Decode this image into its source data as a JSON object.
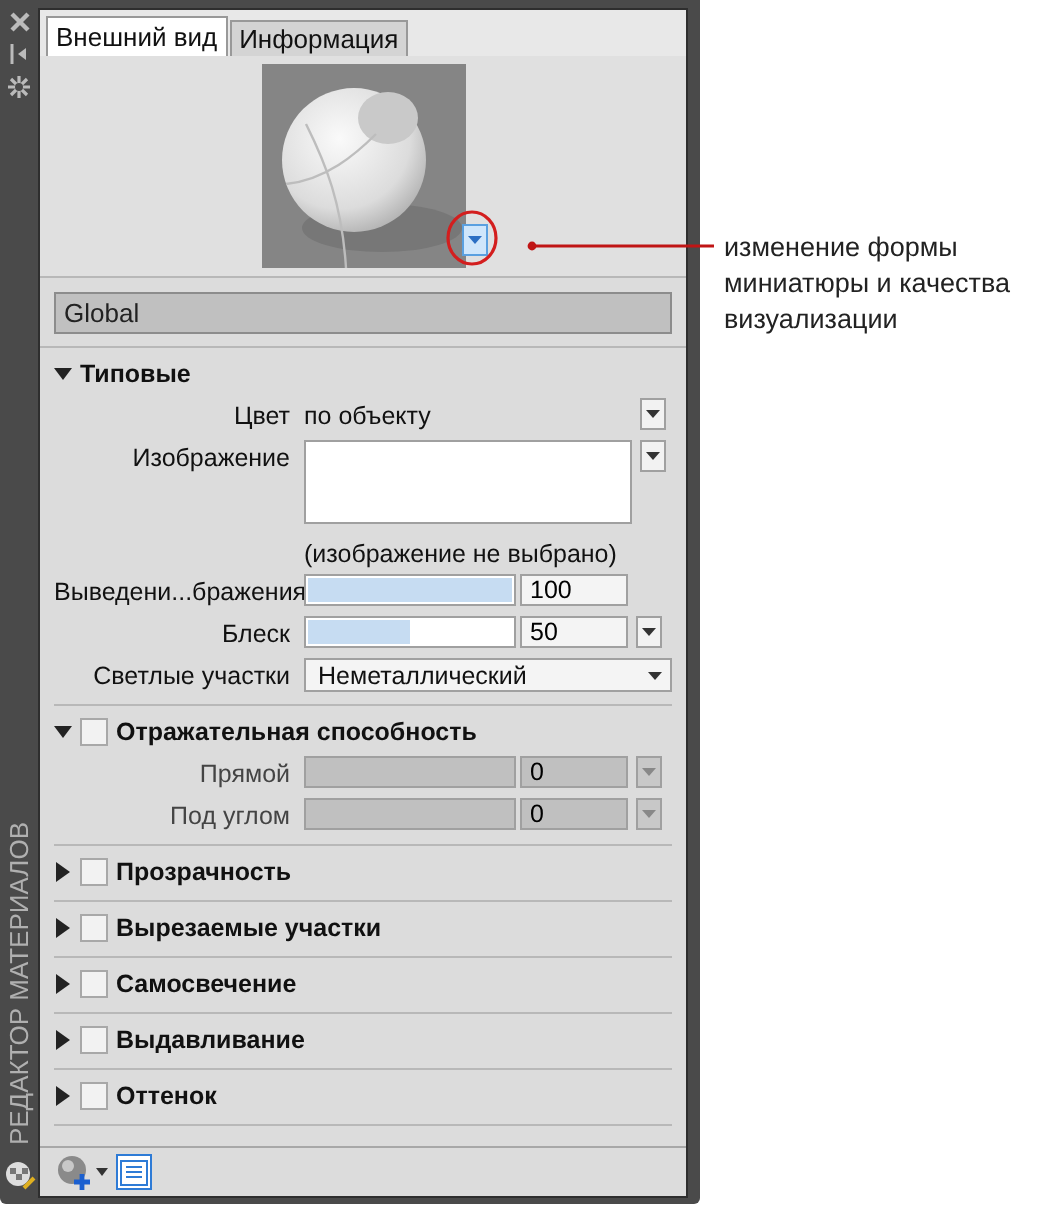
{
  "side_bar": {
    "title": "РЕДАКТОР МАТЕРИАЛОВ"
  },
  "tabs": [
    {
      "label": "Внешний вид",
      "selected": true
    },
    {
      "label": "Информация",
      "selected": false
    }
  ],
  "material_name": "Global",
  "callout": "изменение формы миниатюры и качества визуализации",
  "sections": [
    {
      "title": "Типовые",
      "expanded": true,
      "rows": [
        {
          "kind": "text",
          "label": "Цвет",
          "value": "по объекту",
          "dropdown": true
        },
        {
          "label": "Изображение",
          "note": "(изображение не выбрано)",
          "dropdown": true
        },
        {
          "kind": "slider",
          "label": "Выведени...бражения",
          "level": 1.0,
          "value": "100",
          "disabled": false,
          "dropdown": false
        },
        {
          "kind": "slider",
          "label": "Блеск",
          "level": 0.5,
          "value": "50",
          "disabled": false,
          "dropdown": true
        },
        {
          "kind": "select",
          "label": "Светлые участки",
          "value": "Неметаллический"
        }
      ]
    },
    {
      "title": "Отражательная способность",
      "expanded": true,
      "checked": false,
      "rows": [
        {
          "kind": "slider",
          "label": "Прямой",
          "value": "0",
          "disabled": true,
          "dropdown": true
        },
        {
          "kind": "slider",
          "label": "Под углом",
          "value": "0",
          "disabled": true,
          "dropdown": true
        }
      ]
    },
    {
      "title": "Прозрачность",
      "expanded": false,
      "checked": false
    },
    {
      "title": "Вырезаемые участки",
      "expanded": false,
      "checked": false
    },
    {
      "title": "Самосвечение",
      "expanded": false,
      "checked": false
    },
    {
      "title": "Выдавливание",
      "expanded": false,
      "checked": false
    },
    {
      "title": "Оттенок",
      "expanded": false,
      "checked": false
    }
  ]
}
